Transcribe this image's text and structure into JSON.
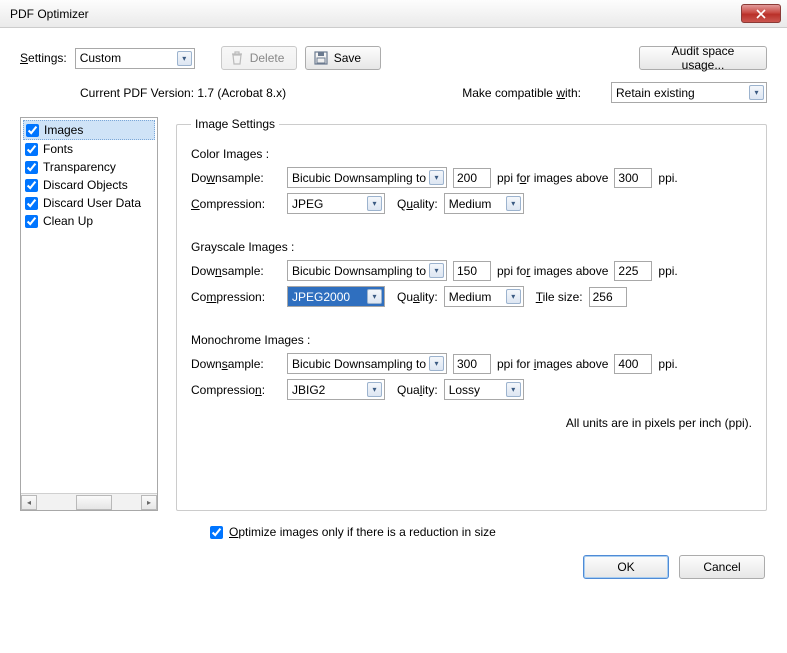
{
  "window": {
    "title": "PDF Optimizer"
  },
  "toolbar": {
    "settings_label": "Settings:",
    "settings_value": "Custom",
    "delete_label": "Delete",
    "save_label": "Save",
    "audit_label": "Audit space usage..."
  },
  "version": {
    "current_label": "Current PDF Version: 1.7 (Acrobat 8.x)",
    "compat_label": "Make compatible with:",
    "compat_value": "Retain existing"
  },
  "sidebar": {
    "items": [
      {
        "label": "Images",
        "checked": true,
        "selected": true
      },
      {
        "label": "Fonts",
        "checked": true,
        "selected": false
      },
      {
        "label": "Transparency",
        "checked": true,
        "selected": false
      },
      {
        "label": "Discard Objects",
        "checked": true,
        "selected": false
      },
      {
        "label": "Discard User Data",
        "checked": true,
        "selected": false
      },
      {
        "label": "Clean Up",
        "checked": true,
        "selected": false
      }
    ]
  },
  "panel": {
    "legend": "Image Settings",
    "color": {
      "header": "Color Images :",
      "downsample_label": "Downsample:",
      "downsample_value": "Bicubic Downsampling to",
      "ppi1": "200",
      "above_label": "ppi for images above",
      "ppi2": "300",
      "ppi_suffix": "ppi.",
      "compression_label": "Compression:",
      "compression_value": "JPEG",
      "quality_label": "Quality:",
      "quality_value": "Medium"
    },
    "gray": {
      "header": "Grayscale Images :",
      "downsample_label": "Downsample:",
      "downsample_value": "Bicubic Downsampling to",
      "ppi1": "150",
      "above_label": "ppi for images above",
      "ppi2": "225",
      "ppi_suffix": "ppi.",
      "compression_label": "Compression:",
      "compression_value": "JPEG2000",
      "quality_label": "Quality:",
      "quality_value": "Medium",
      "tile_label": "Tile size:",
      "tile_value": "256"
    },
    "mono": {
      "header": "Monochrome Images :",
      "downsample_label": "Downsample:",
      "downsample_value": "Bicubic Downsampling to",
      "ppi1": "300",
      "above_label": "ppi for images above",
      "ppi2": "400",
      "ppi_suffix": "ppi.",
      "compression_label": "Compression:",
      "compression_value": "JBIG2",
      "quality_label": "Quality:",
      "quality_value": "Lossy"
    },
    "units_note": "All units are in pixels per inch (ppi)."
  },
  "optimize": {
    "checked": true,
    "label": "Optimize images only if there is a reduction in size"
  },
  "footer": {
    "ok_label": "OK",
    "cancel_label": "Cancel"
  }
}
